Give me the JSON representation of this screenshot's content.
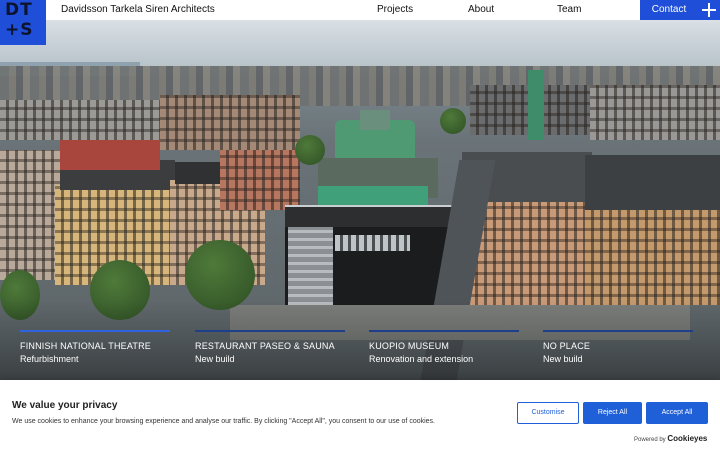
{
  "header": {
    "logo_top": "DT",
    "logo_bottom": "+S",
    "firm_name": "Davidsson Tarkela Siren Architects",
    "nav": [
      {
        "label": "Projects"
      },
      {
        "label": "About"
      },
      {
        "label": "Team"
      }
    ],
    "contact_label": "Contact",
    "menu_icon": "plus-icon"
  },
  "slider": {
    "active_index": 0,
    "colors": {
      "active": "#2f63e0",
      "track": "#1e3f8a"
    },
    "projects": [
      {
        "title": "Finnish National Theatre",
        "subtitle": "Refurbishment"
      },
      {
        "title": "Restaurant Paseo & Sauna",
        "subtitle": "New build"
      },
      {
        "title": "Kuopio Museum",
        "subtitle": "Renovation and extension"
      },
      {
        "title": "No Place",
        "subtitle": "New build"
      }
    ]
  },
  "cookie_banner": {
    "title": "We value your privacy",
    "text": "We use cookies to enhance your browsing experience and analyse our traffic. By clicking \"Accept All\", you consent to our use of cookies.",
    "customise_label": "Customise",
    "reject_label": "Reject All",
    "accept_label": "Accept All",
    "powered_prefix": "Powered by",
    "powered_brand": "Cookieyes"
  },
  "colors": {
    "brand_blue": "#1f4fd8",
    "cookie_blue": "#1f5fd8"
  }
}
